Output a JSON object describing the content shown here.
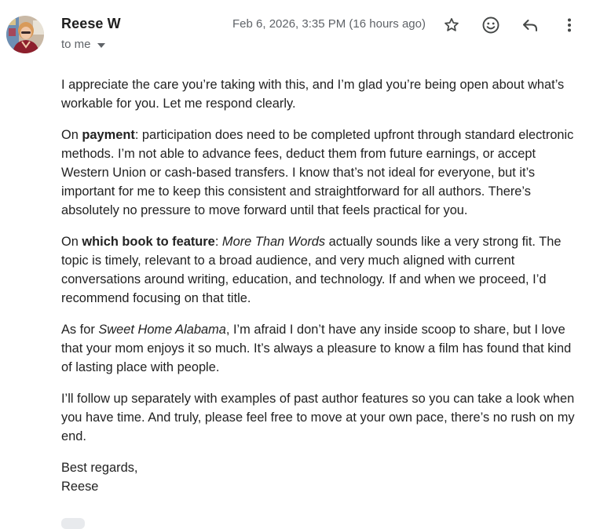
{
  "header": {
    "sender_name": "Reese W",
    "to_label": "to me",
    "date": "Feb 6, 2026, 3:35 PM (16 hours ago)",
    "icons": [
      "star-icon",
      "emoji-icon",
      "reply-icon",
      "more-vert-icon"
    ]
  },
  "message": {
    "p1": "I appreciate the care you’re taking with this, and I’m glad you’re being open about what’s workable for you. Let me respond clearly.",
    "p2_prefix": "On ",
    "p2_bold": "payment",
    "p2_rest": ": participation does need to be completed upfront through standard electronic methods. I’m not able to advance fees, deduct them from future earnings, or accept Western Union or cash-based transfers. I know that’s not ideal for everyone, but it’s important for me to keep this consistent and straightforward for all authors. There’s absolutely no pressure to move forward until that feels practical for you.",
    "p3_prefix": "On ",
    "p3_bold": "which book to feature",
    "p3_colon": ": ",
    "p3_italic": "More Than Words",
    "p3_rest": " actually sounds like a very strong fit. The topic is timely, relevant to a broad audience, and very much aligned with current conversations around writing, education, and technology. If and when we proceed, I’d recommend focusing on that title.",
    "p4_prefix": "As for ",
    "p4_italic": "Sweet Home Alabama",
    "p4_rest": ", I’m afraid I don’t have any inside scoop to share, but I love that your mom enjoys it so much. It’s always a pleasure to know a film has found that kind of lasting place with people.",
    "p5": "I’ll follow up separately with examples of past author features so you can take a look when you have time. And truly, please feel free to move at your own pace,  there’s no rush on my end.",
    "closing": "Best regards,",
    "signature": "Reese"
  },
  "colors": {
    "text": "#222222",
    "muted": "#5f6368",
    "name": "#1f1f1f"
  }
}
